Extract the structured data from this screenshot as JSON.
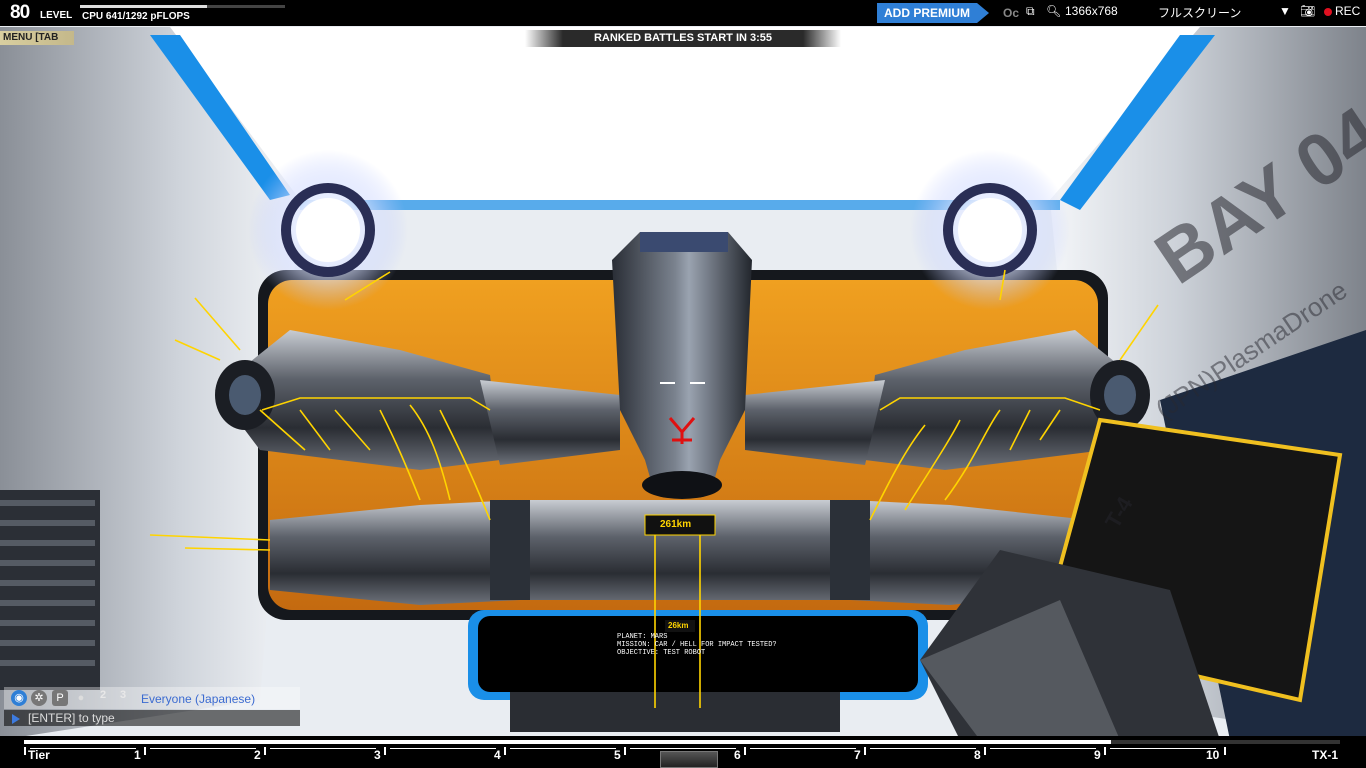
{
  "hud": {
    "level_number": "80",
    "level_label": "LEVEL",
    "xp_progress": 0.62,
    "cpu": "CPU 641/1292 pFLOPS",
    "premium_button": "ADD PREMIUM",
    "partial_text": "Oc",
    "menu_tab": "MENU [TAB",
    "ranked_banner": "RANKED BATTLES START IN 3:55"
  },
  "capture_overlay": {
    "resolution": "1366x768",
    "mode": "フルスクリーン",
    "rec_label": "REC"
  },
  "bay_sign": {
    "bay": "BAY 04",
    "owner": "(JPN)PlasmaDrone",
    "tier": "T-4"
  },
  "robot_labels": {
    "speed_top": "261km",
    "speed_bottom": "26km"
  },
  "mission_panel": {
    "line1": "PLANET: MARS",
    "line2": "MISSION: CAR / HELL FOR IMPACT TESTED?",
    "line3": "OBJECTIVE: TEST ROBOT"
  },
  "chat": {
    "tabs": [
      "1",
      "2",
      "3"
    ],
    "channel": "Everyone (Japanese)",
    "input_hint": "[ENTER] to type"
  },
  "tier_bar": {
    "start_label": "Tier",
    "labels": [
      "1",
      "2",
      "3",
      "4",
      "5",
      "6",
      "7",
      "8",
      "9",
      "10"
    ],
    "end_label": "TX-1",
    "progress": 0.826
  },
  "colors": {
    "premium": "#2f7fd6",
    "accent_yellow": "#ffd400",
    "chat_channel": "#3b6bd1",
    "rec_red": "#e01020"
  }
}
